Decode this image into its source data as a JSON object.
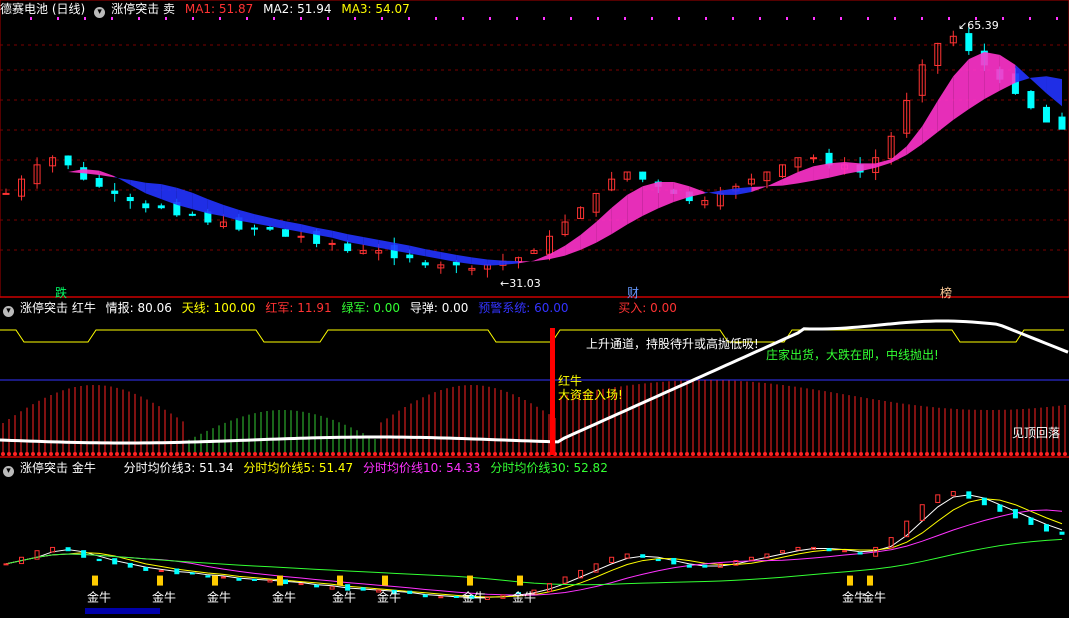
{
  "panel1": {
    "stock": "德赛电池 (日线)",
    "indicator": "涨停突击 卖",
    "ma": [
      {
        "label": "MA1: 51.87",
        "color": "#ff3333"
      },
      {
        "label": "MA2: 51.94",
        "color": "#ffffff"
      },
      {
        "label": "MA3: 54.07",
        "color": "#ffff00"
      }
    ],
    "high_label": "65.39",
    "low_label": "31.03",
    "markers": [
      {
        "text": "跌",
        "color": "#00ff66"
      },
      {
        "text": "财",
        "color": "#6699ff"
      },
      {
        "text": "榜",
        "color": "#ffcc99"
      }
    ]
  },
  "panel2": {
    "indicator": "涨停突击 红牛",
    "values": [
      {
        "label": "情报: 80.06",
        "color": "#ffffff"
      },
      {
        "label": "天线: 100.00",
        "color": "#ffff00"
      },
      {
        "label": "红军: 11.91",
        "color": "#ff3333"
      },
      {
        "label": "绿军: 0.00",
        "color": "#33ff33"
      },
      {
        "label": "导弹: 0.00",
        "color": "#ffffff"
      },
      {
        "label": "预警系统: 60.00",
        "color": "#3333ff"
      },
      {
        "label": "买入: 0.00",
        "color": "#ff3333"
      }
    ],
    "annotations": [
      {
        "text": "上升通道，持股待升或高抛低吸!",
        "color": "#ffffff"
      },
      {
        "text": "庄家出货，大跌在即，中线抛出!",
        "color": "#33ff33"
      },
      {
        "text": "红牛",
        "color": "#ffff00"
      },
      {
        "text": "大资金入场!",
        "color": "#ffff00"
      },
      {
        "text": "见顶回落",
        "color": "#ffffff"
      }
    ]
  },
  "panel3": {
    "indicator": "涨停突击 金牛",
    "values": [
      {
        "label": "分时均价线3: 51.34",
        "color": "#ffffff"
      },
      {
        "label": "分时均价线5: 51.47",
        "color": "#ffff00"
      },
      {
        "label": "分时均价线10: 54.33",
        "color": "#ff33ff"
      },
      {
        "label": "分时均价线30: 52.82",
        "color": "#33ff33"
      }
    ],
    "signal_label": "金牛"
  },
  "chart_data": {
    "type": "candlestick",
    "high": 65.39,
    "low": 31.03,
    "ma": {
      "MA1": 51.87,
      "MA2": 51.94,
      "MA3": 54.07
    },
    "closes": [
      42,
      44,
      46,
      47,
      46,
      44,
      43,
      42,
      41,
      40,
      40,
      39,
      39,
      38,
      38,
      37,
      37,
      37,
      36,
      36,
      35,
      35,
      34,
      34,
      34,
      33,
      33,
      32,
      32,
      32,
      31.5,
      32,
      32.5,
      33,
      34,
      36,
      38,
      40,
      42,
      44,
      45,
      44,
      43,
      42,
      41,
      41,
      42,
      43,
      44,
      45,
      46,
      47,
      47,
      46,
      46,
      45,
      47,
      50,
      55,
      60,
      63,
      64,
      62,
      60,
      58,
      56,
      54,
      52,
      51
    ]
  },
  "colors": {
    "bg": "#000000",
    "up": "#ff3333",
    "down": "#00ffff",
    "grid": "#8b0000"
  }
}
